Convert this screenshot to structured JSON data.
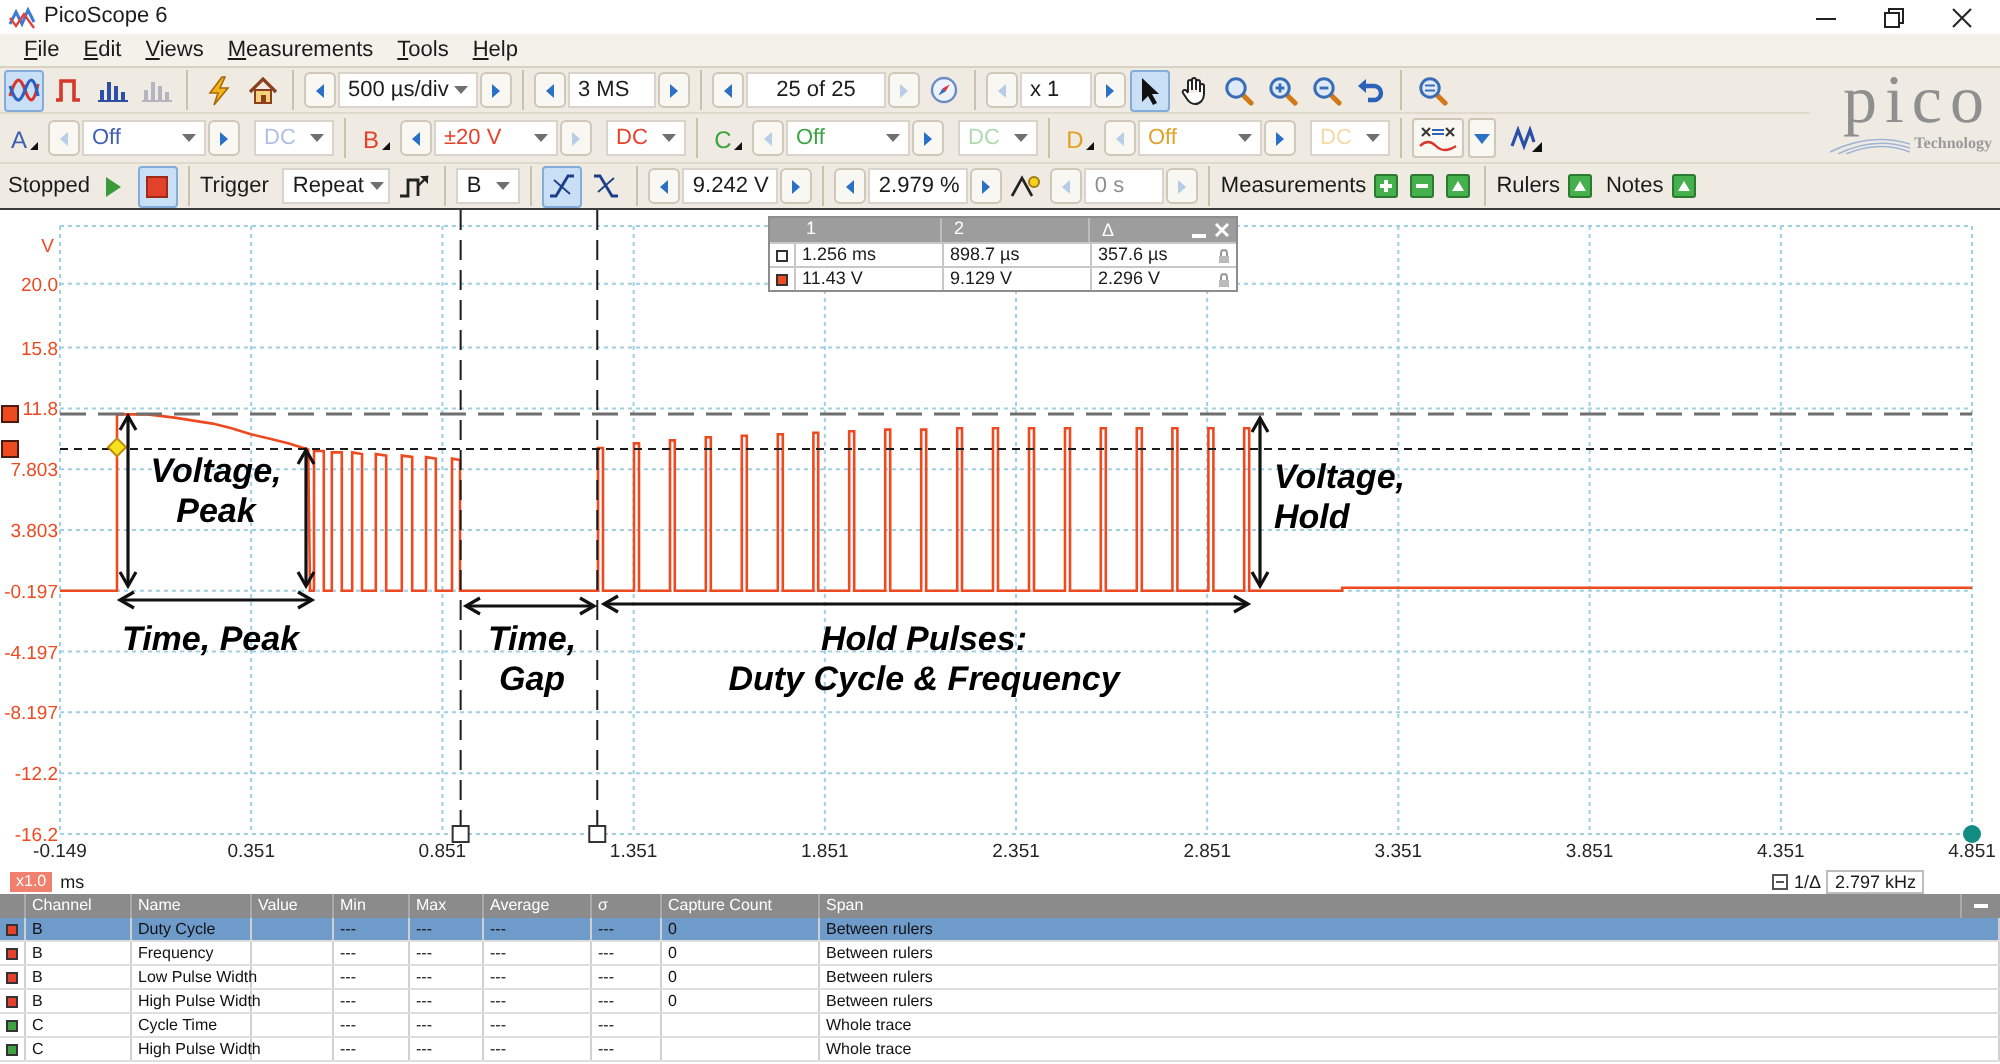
{
  "window": {
    "title": "PicoScope 6"
  },
  "menu": [
    {
      "label": "File"
    },
    {
      "label": "Edit"
    },
    {
      "label": "Views"
    },
    {
      "label": "Measurements"
    },
    {
      "label": "Tools"
    },
    {
      "label": "Help"
    }
  ],
  "toolbar": {
    "modes": [
      {
        "selected": true,
        "disabled": false
      },
      {
        "selected": false,
        "disabled": false
      },
      {
        "selected": false,
        "disabled": false
      },
      {
        "selected": false,
        "disabled": true
      }
    ],
    "timebase": {
      "value": "500 µs/div",
      "prev_disabled": false,
      "next_disabled": false
    },
    "samples": {
      "value": "3 MS",
      "prev_disabled": false,
      "next_disabled": false
    },
    "buffer": {
      "value": "25 of 25",
      "prev_disabled": false,
      "next_disabled": true
    },
    "zoom": {
      "value": "x 1",
      "prev_disabled": true,
      "next_disabled": false
    },
    "tools": [
      {
        "selected": true
      },
      {
        "selected": false
      },
      {
        "selected": false
      },
      {
        "selected": false
      },
      {
        "selected": false
      }
    ]
  },
  "logo": {
    "name": "pico",
    "tagline": "Technology"
  },
  "channels": [
    {
      "name": "A",
      "color": "#3d5fb3",
      "range": {
        "value": "Off",
        "prev_disabled": true,
        "next_disabled": false
      },
      "coupling": {
        "value": "DC",
        "disabled": true
      }
    },
    {
      "name": "B",
      "color": "#e5412b",
      "range": {
        "value": "±20 V",
        "prev_disabled": false,
        "next_disabled": true
      },
      "coupling": {
        "value": "DC",
        "disabled": false
      }
    },
    {
      "name": "C",
      "color": "#3ba33f",
      "range": {
        "value": "Off",
        "prev_disabled": true,
        "next_disabled": false
      },
      "coupling": {
        "value": "DC",
        "disabled": true
      }
    },
    {
      "name": "D",
      "color": "#e0a126",
      "range": {
        "value": "Off",
        "prev_disabled": true,
        "next_disabled": false
      },
      "coupling": {
        "value": "DC",
        "disabled": true
      }
    }
  ],
  "capture_bar": {
    "status": "Stopped",
    "run": {
      "selected": false
    },
    "stop": {
      "selected": true
    },
    "trigger_label": "Trigger",
    "trigger_mode": "Repeat",
    "trigger_source": "B",
    "edges": [
      {
        "selected": true
      },
      {
        "selected": false
      }
    ],
    "threshold": {
      "value": "9.242 V",
      "prev_disabled": false,
      "next_disabled": false
    },
    "pretrigger": {
      "value": "2.979 %",
      "prev_disabled": false,
      "next_disabled": false
    },
    "delay": {
      "value": "0 s",
      "disabled": true
    },
    "measurements_label": "Measurements",
    "rulers_label": "Rulers",
    "notes_label": "Notes"
  },
  "scope": {
    "chart_data": {
      "type": "line",
      "xlabel": "ms",
      "ylabel": "V",
      "grid": true,
      "xlim": [
        -0.149,
        4.851
      ],
      "ylim": [
        -16.2,
        23.8
      ],
      "xticks": [
        -0.149,
        0.351,
        0.851,
        1.351,
        1.851,
        2.351,
        2.851,
        3.351,
        3.851,
        4.351,
        4.851
      ],
      "yticks": [
        {
          "value": 20,
          "label": "20.0"
        },
        15.8,
        11.8,
        7.803,
        3.803,
        -0.197,
        -4.197,
        -8.197,
        -12.2,
        -16.2
      ],
      "x": [
        -0.149,
        0,
        0,
        0.08,
        0.15,
        0.2,
        0.25,
        0.3,
        0.35,
        0.4,
        0.45,
        0.5,
        0.505,
        0.515,
        0.515,
        0.541,
        0.541,
        0.562,
        0.562,
        0.588,
        0.588,
        0.615,
        0.615,
        0.641,
        0.641,
        0.677,
        0.677,
        0.704,
        0.704,
        0.745,
        0.745,
        0.772,
        0.772,
        0.808,
        0.808,
        0.834,
        0.834,
        0.876,
        0.876,
        0.897,
        0.897,
        1.258,
        1.258,
        1.271,
        1.271,
        1.352,
        1.352,
        1.365,
        1.365,
        1.446,
        1.446,
        1.459,
        1.459,
        1.54,
        1.54,
        1.553,
        1.553,
        1.634,
        1.634,
        1.647,
        1.647,
        1.728,
        1.728,
        1.741,
        1.741,
        1.821,
        1.821,
        1.834,
        1.834,
        1.915,
        1.915,
        1.928,
        1.928,
        2.009,
        2.009,
        2.022,
        2.022,
        2.103,
        2.103,
        2.116,
        2.116,
        2.197,
        2.197,
        2.21,
        2.21,
        2.291,
        2.291,
        2.304,
        2.304,
        2.385,
        2.385,
        2.398,
        2.398,
        2.479,
        2.479,
        2.492,
        2.492,
        2.573,
        2.573,
        2.586,
        2.586,
        2.667,
        2.667,
        2.68,
        2.68,
        2.76,
        2.76,
        2.773,
        2.773,
        2.854,
        2.854,
        2.867,
        2.867,
        2.948,
        2.948,
        2.961,
        2.961,
        3.204,
        3.204,
        4.851
      ],
      "series": [
        {
          "color": "#ee4a22",
          "values": [
            -0.2,
            -0.2,
            11.4,
            11.4,
            11.2,
            11.0,
            10.8,
            10.5,
            10.1,
            9.8,
            9.5,
            9.1,
            -0.2,
            -0.2,
            9.0,
            9.0,
            -0.2,
            -0.2,
            8.9,
            8.9,
            -0.2,
            -0.2,
            8.9,
            8.8,
            -0.2,
            -0.2,
            8.8,
            8.7,
            -0.2,
            -0.2,
            8.7,
            8.6,
            -0.2,
            -0.2,
            8.6,
            8.5,
            -0.2,
            -0.2,
            8.5,
            8.4,
            -0.2,
            -0.2,
            9.2,
            9.2,
            -0.2,
            -0.2,
            9.5,
            9.5,
            -0.2,
            -0.2,
            9.7,
            9.7,
            -0.2,
            -0.2,
            9.9,
            9.9,
            -0.2,
            -0.2,
            10,
            10,
            -0.2,
            -0.2,
            10.1,
            10.1,
            -0.2,
            -0.2,
            10.2,
            10.2,
            -0.2,
            -0.2,
            10.3,
            10.3,
            -0.2,
            -0.2,
            10.4,
            10.4,
            -0.2,
            -0.2,
            10.4,
            10.4,
            -0.2,
            -0.2,
            10.5,
            10.5,
            -0.2,
            -0.2,
            10.5,
            10.5,
            -0.2,
            -0.2,
            10.5,
            10.5,
            -0.2,
            -0.2,
            10.5,
            10.5,
            -0.2,
            -0.2,
            10.5,
            10.5,
            -0.2,
            -0.2,
            10.5,
            10.5,
            -0.2,
            -0.2,
            10.5,
            10.5,
            -0.2,
            -0.2,
            10.5,
            10.5,
            -0.2,
            -0.2,
            10.5,
            10.5,
            -0.2,
            -0.2,
            0.0,
            0.0
          ]
        }
      ],
      "ref_lines": [
        {
          "axis": "y",
          "value": 11.43
        },
        {
          "axis": "y",
          "value": 9.129
        },
        {
          "axis": "x",
          "value": 1.256
        },
        {
          "axis": "x",
          "value": 0.8987
        }
      ]
    },
    "ruler_table": {
      "headers": [
        "1",
        "2",
        "Δ"
      ],
      "rows": [
        {
          "kind": "time",
          "values": [
            "1.256 ms",
            "898.7 µs",
            "357.6 µs"
          ]
        },
        {
          "kind": "voltage",
          "values": [
            "11.43 V",
            "9.129 V",
            "2.296 V"
          ]
        }
      ]
    },
    "callouts": [
      {
        "text": "Voltage,\nPeak"
      },
      {
        "text": "Time, Peak"
      },
      {
        "text": "Time,\nGap"
      },
      {
        "text": "Hold Pulses:\nDuty Cycle & Frequency"
      },
      {
        "text": "Voltage,\nHold"
      }
    ],
    "zoom_badge": "x1.0",
    "ruler_readout": {
      "label": "1/Δ",
      "value": "2.797 kHz"
    }
  },
  "measurements_table": {
    "columns": [
      "Channel",
      "Name",
      "Value",
      "Min",
      "Max",
      "Average",
      "σ",
      "Capture Count",
      "Span"
    ],
    "rows": [
      {
        "selected": true,
        "color": "#e5412b",
        "channel": "B",
        "name": "Duty Cycle",
        "min": "---",
        "max": "---",
        "average": "---",
        "sigma": "---",
        "capture_count": "0",
        "span": "Between rulers"
      },
      {
        "selected": false,
        "color": "#e5412b",
        "channel": "B",
        "name": "Frequency",
        "min": "---",
        "max": "---",
        "average": "---",
        "sigma": "---",
        "capture_count": "0",
        "span": "Between rulers"
      },
      {
        "selected": false,
        "color": "#e5412b",
        "channel": "B",
        "name": "Low Pulse Width",
        "min": "---",
        "max": "---",
        "average": "---",
        "sigma": "---",
        "capture_count": "0",
        "span": "Between rulers"
      },
      {
        "selected": false,
        "color": "#e5412b",
        "channel": "B",
        "name": "High Pulse Width",
        "min": "---",
        "max": "---",
        "average": "---",
        "sigma": "---",
        "capture_count": "0",
        "span": "Between rulers"
      },
      {
        "selected": false,
        "color": "#3ba33f",
        "channel": "C",
        "name": "Cycle Time",
        "min": "---",
        "max": "---",
        "average": "---",
        "sigma": "---",
        "span": "Whole trace"
      },
      {
        "selected": false,
        "color": "#3ba33f",
        "channel": "C",
        "name": "High Pulse Width",
        "min": "---",
        "max": "---",
        "average": "---",
        "sigma": "---",
        "span": "Whole trace"
      }
    ]
  }
}
